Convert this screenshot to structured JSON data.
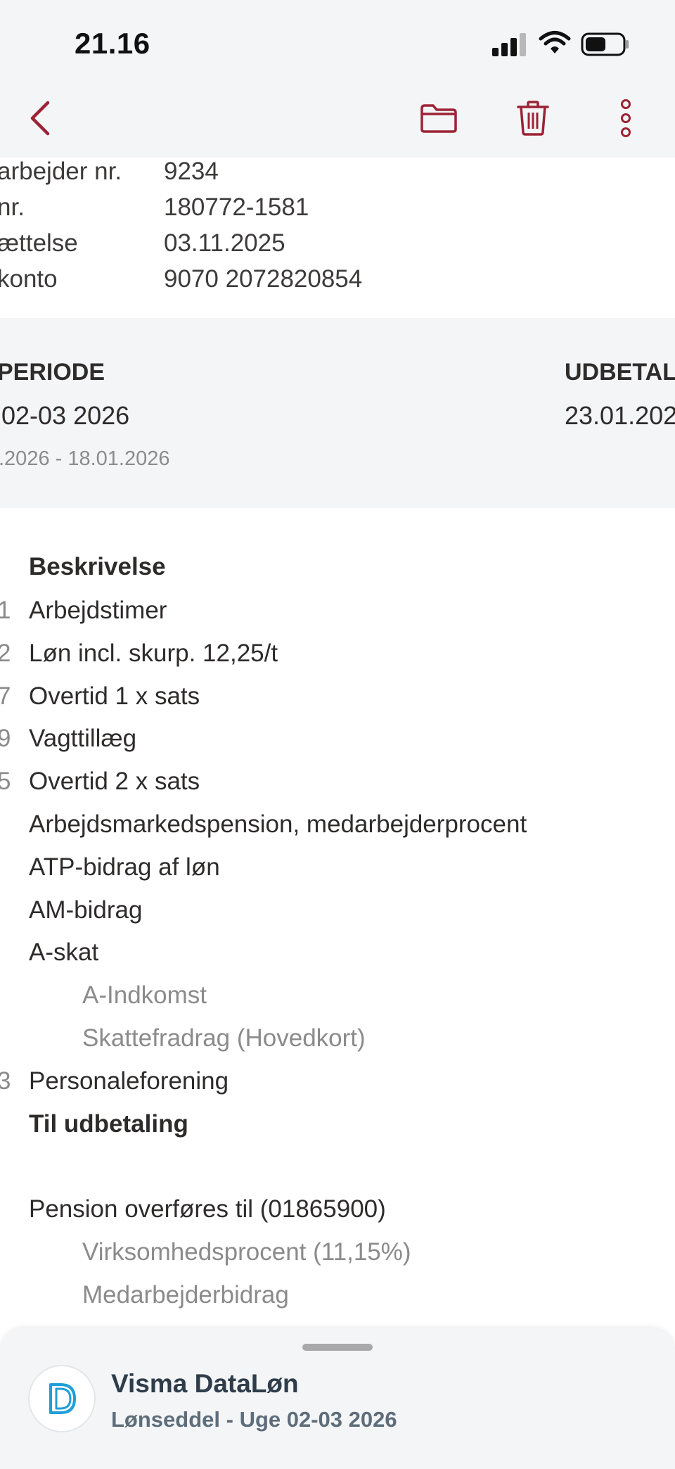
{
  "status_bar": {
    "time": "21.16"
  },
  "nav": {
    "back_icon": "chevron-left-icon",
    "folder_icon": "folder-icon",
    "trash_icon": "trash-icon",
    "more_icon": "more-vertical-icon",
    "accent_color": "#9b2335"
  },
  "employee_info": [
    {
      "label": "arbejder nr.",
      "value": "9234"
    },
    {
      "label": "nr.",
      "value": "180772-1581"
    },
    {
      "label": "ættelse",
      "value": "03.11.2025"
    },
    {
      "label": "konto",
      "value": "9070 2072820854"
    }
  ],
  "period": {
    "left_heading": "PERIODE",
    "left_value": "02-03 2026",
    "left_range": ".2026 - 18.01.2026",
    "right_heading": "UDBETAL",
    "right_value": "23.01.202"
  },
  "description": {
    "heading": "Beskrivelse",
    "rows": [
      {
        "code": "1",
        "text": "Arbejdstimer"
      },
      {
        "code": "2",
        "text": "Løn incl. skurp. 12,25/t"
      },
      {
        "code": "7",
        "text": "Overtid 1 x sats"
      },
      {
        "code": "9",
        "text": "Vagttillæg"
      },
      {
        "code": "5",
        "text": "Overtid 2 x sats"
      },
      {
        "code": "",
        "text": "Arbejdsmarkedspension, medarbejderprocent"
      },
      {
        "code": "",
        "text": "ATP-bidrag af løn"
      },
      {
        "code": "",
        "text": "AM-bidrag"
      },
      {
        "code": "",
        "text": "A-skat"
      },
      {
        "code": "",
        "text": "A-Indkomst"
      },
      {
        "code": "",
        "text": "Skattefradrag (Hovedkort)"
      },
      {
        "code": "3",
        "text": "Personaleforening"
      },
      {
        "code": "",
        "text": "Til udbetaling"
      },
      {
        "code": "",
        "text": "Pension overføres til (01865900)"
      },
      {
        "code": "",
        "text": "Virksomhedsprocent (11,15%)"
      },
      {
        "code": "",
        "text": "Medarbejderbidrag"
      }
    ]
  },
  "bottom_sheet": {
    "app_name": "Visma DataLøn",
    "subtitle": "Lønseddel - Uge 02-03 2026",
    "logo_icon": "visma-d-logo-icon"
  }
}
